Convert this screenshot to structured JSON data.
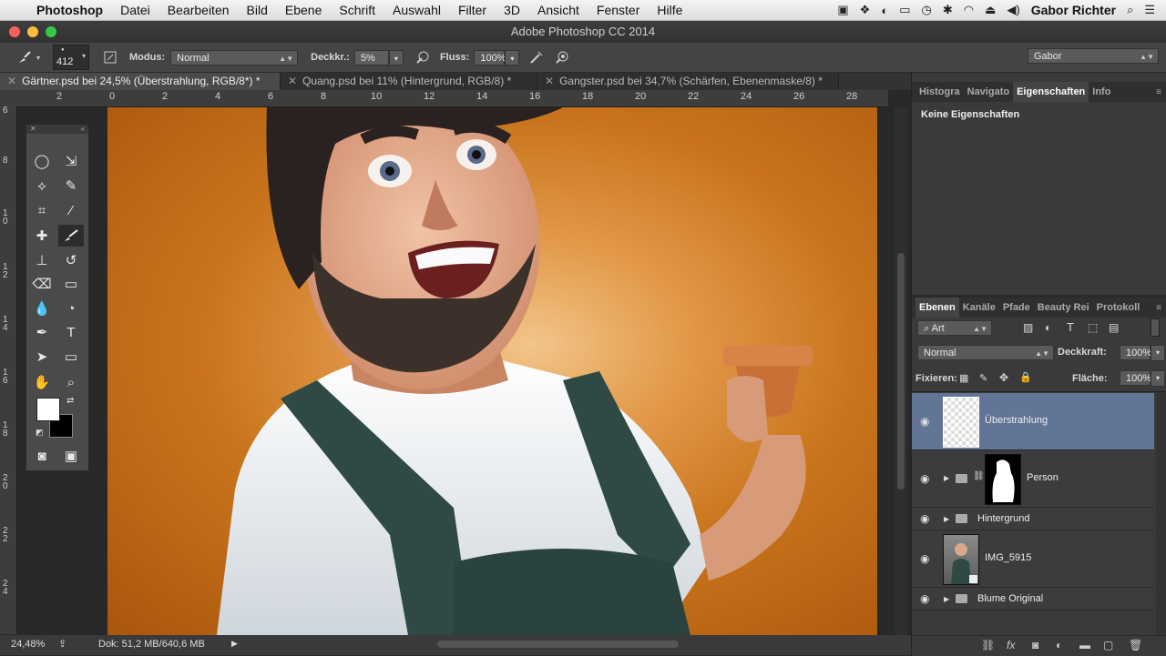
{
  "menubar": {
    "app": "Photoshop",
    "items": [
      "Datei",
      "Bearbeiten",
      "Bild",
      "Ebene",
      "Schrift",
      "Auswahl",
      "Filter",
      "3D",
      "Ansicht",
      "Fenster",
      "Hilfe"
    ],
    "user": "Gabor Richter"
  },
  "window": {
    "title": "Adobe Photoshop CC 2014"
  },
  "options": {
    "brush_size": "412",
    "modus_label": "Modus:",
    "modus_value": "Normal",
    "deckkr_label": "Deckkr.:",
    "deckkr_value": "5%",
    "fluss_label": "Fluss:",
    "fluss_value": "100%",
    "workspace": "Gabor"
  },
  "tabs": [
    {
      "label": "Gärtner.psd bei 24,5% (Überstrahlung, RGB/8*) *"
    },
    {
      "label": "Quang.psd bei 11% (Hintergrund, RGB/8) *"
    },
    {
      "label": "Gangster.psd bei 34,7% (Schärfen, Ebenenmaske/8) *"
    }
  ],
  "ruler_top": [
    "2",
    "0",
    "2",
    "4",
    "6",
    "8",
    "10",
    "12",
    "14",
    "16",
    "18",
    "20",
    "22",
    "24",
    "26",
    "28"
  ],
  "ruler_left": [
    "6",
    "8",
    "1 0",
    "1 2",
    "1 4",
    "1 6",
    "1 8",
    "2 0",
    "2 2",
    "2 4"
  ],
  "status": {
    "zoom": "24,48%",
    "doc": "Dok: 51,2 MB/640,6 MB"
  },
  "properties_panel": {
    "tabs": [
      "Histogra",
      "Navigato",
      "Eigenschaften",
      "Info"
    ],
    "content": "Keine Eigenschaften"
  },
  "layers_panel": {
    "tabs": [
      "Ebenen",
      "Kanäle",
      "Pfade",
      "Beauty Rei",
      "Protokoll"
    ],
    "filter": "Art",
    "blend_mode": "Normal",
    "opacity_label": "Deckkraft:",
    "opacity_value": "100%",
    "lock_label": "Fixieren:",
    "fill_label": "Fläche:",
    "fill_value": "100%",
    "layers": [
      {
        "name": "Überstrahlung",
        "selected": true
      },
      {
        "name": "Person",
        "selected": false
      },
      {
        "name": "Hintergrund",
        "selected": false
      },
      {
        "name": "IMG_5915",
        "selected": false
      },
      {
        "name": "Blume Original",
        "selected": false
      }
    ]
  },
  "colors": {
    "background_orange": "#c9741c",
    "layer_selected": "#627596",
    "panel_bg": "#3a3a3a"
  }
}
